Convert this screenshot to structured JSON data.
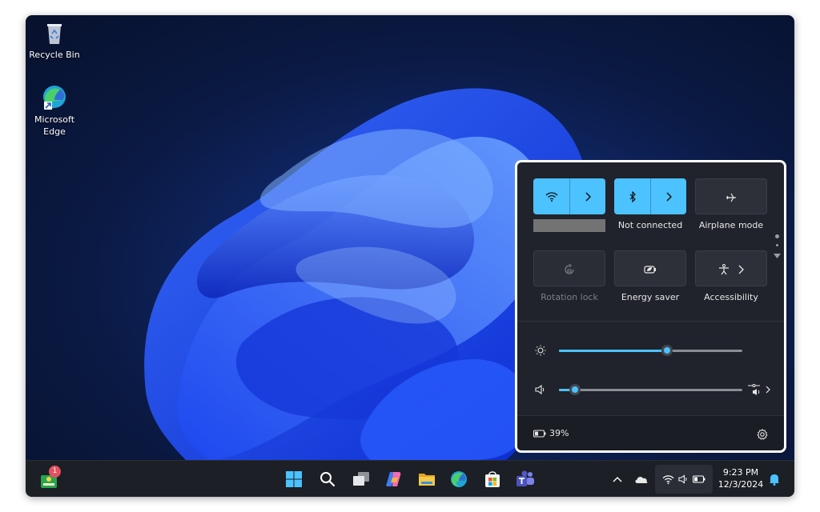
{
  "desktop": {
    "icons": [
      {
        "label": "Recycle Bin"
      },
      {
        "label": "Microsoft Edge"
      }
    ]
  },
  "quick_settings": {
    "tiles": [
      {
        "id": "wifi",
        "label": "",
        "state": "on",
        "icon": "wifi-icon",
        "expandable": true,
        "label_redacted": true
      },
      {
        "id": "bluetooth",
        "label": "Not connected",
        "state": "on",
        "icon": "bluetooth-icon",
        "expandable": true
      },
      {
        "id": "airplane",
        "label": "Airplane mode",
        "state": "off",
        "icon": "airplane-icon",
        "expandable": false
      },
      {
        "id": "rotation",
        "label": "Rotation lock",
        "state": "disabled",
        "icon": "rotation-lock-icon",
        "expandable": false
      },
      {
        "id": "energy",
        "label": "Energy saver",
        "state": "off",
        "icon": "energy-saver-icon",
        "expandable": false
      },
      {
        "id": "accessibility",
        "label": "Accessibility",
        "state": "off",
        "icon": "accessibility-icon",
        "expandable": true
      }
    ],
    "brightness": {
      "icon": "brightness-icon",
      "value": 0.59
    },
    "volume": {
      "icon": "speaker-icon",
      "value": 0.04,
      "output_icon": "audio-output-icon"
    },
    "battery": {
      "icon": "battery-icon",
      "label": "39%"
    },
    "settings_icon": "gear-icon",
    "page_indicator": {
      "pages": 2,
      "current": 1
    }
  },
  "taskbar": {
    "widgets": {
      "icon": "widgets-icon",
      "badge": "1"
    },
    "apps": [
      {
        "name": "start",
        "icon": "windows-start-icon"
      },
      {
        "name": "search",
        "icon": "search-icon"
      },
      {
        "name": "task-view",
        "icon": "task-view-icon"
      },
      {
        "name": "copilot",
        "icon": "copilot-icon"
      },
      {
        "name": "file-explorer",
        "icon": "folder-icon"
      },
      {
        "name": "edge",
        "icon": "edge-icon"
      },
      {
        "name": "store",
        "icon": "store-icon"
      },
      {
        "name": "teams",
        "icon": "teams-icon"
      }
    ],
    "tray": {
      "time": "9:23 PM",
      "date": "12/3/2024"
    }
  },
  "colors": {
    "accent": "#4cc2ff",
    "panel_bg": "#20232b",
    "taskbar_bg": "#1c1f26",
    "badge": "#e3515e"
  }
}
